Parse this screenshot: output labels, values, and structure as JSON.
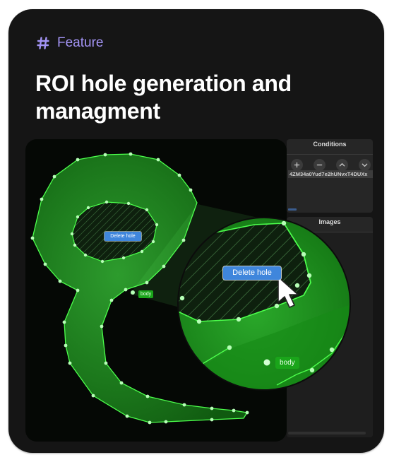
{
  "tag": {
    "icon": "hash-icon",
    "label": "Feature",
    "color": "#a394f5"
  },
  "headline": "ROI hole generation and managment",
  "conditions_panel": {
    "title": "Conditions",
    "controls": [
      {
        "name": "add",
        "icon": "plus-icon"
      },
      {
        "name": "remove",
        "icon": "minus-icon"
      },
      {
        "name": "move-up",
        "icon": "chevron-up-icon"
      },
      {
        "name": "move-down",
        "icon": "chevron-down-icon"
      }
    ],
    "item_id": "4ZM34a0Yud7e2hUNvxT4DUXx"
  },
  "images_panel": {
    "title": "Images"
  },
  "roi": {
    "delete_hole_label": "Delete hole",
    "body_label": "body",
    "roi_color": "#39ff39",
    "button_color": "#3f86dc"
  },
  "colors": {
    "card_background": "#151515",
    "headline": "#ffffff",
    "accent": "#a394f5"
  }
}
